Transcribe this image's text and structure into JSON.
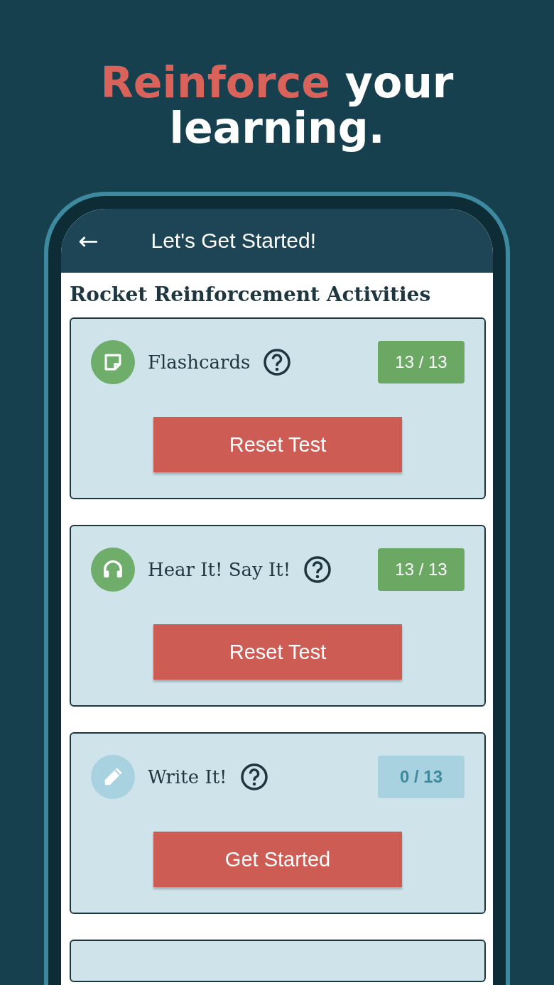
{
  "headline": {
    "accent": "Reinforce",
    "rest": "your learning."
  },
  "app_bar": {
    "back": "←",
    "title": "Let's Get Started!"
  },
  "section_title": "Rocket Reinforcement Activities",
  "activities": [
    {
      "kind": "flashcard",
      "title": "Flashcards",
      "completed": true,
      "progress": "13 / 13",
      "button": "Reset Test"
    },
    {
      "kind": "headphones",
      "title": "Hear It! Say It!",
      "completed": true,
      "progress": "13 / 13",
      "button": "Reset Test"
    },
    {
      "kind": "pencil",
      "title": "Write It!",
      "completed": false,
      "progress": "0 / 13",
      "button": "Get Started"
    }
  ]
}
